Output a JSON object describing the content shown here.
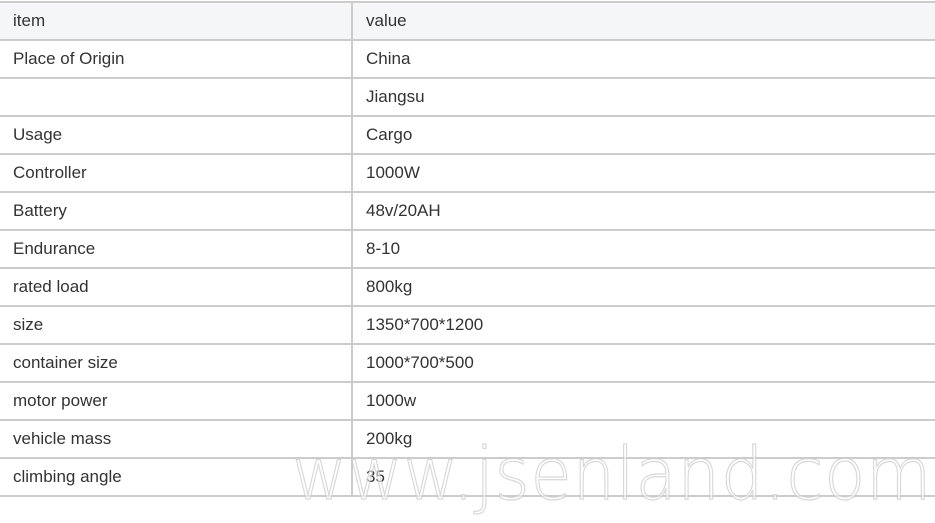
{
  "table": {
    "headers": {
      "item": "item",
      "value": "value"
    },
    "rows": [
      {
        "item": "Place of Origin",
        "value": "China"
      },
      {
        "item": "",
        "value": "Jiangsu"
      },
      {
        "item": "Usage",
        "value": "Cargo"
      },
      {
        "item": "Controller",
        "value": "1000W"
      },
      {
        "item": "Battery",
        "value": "48v/20AH"
      },
      {
        "item": "Endurance",
        "value": "8-10"
      },
      {
        "item": "rated load",
        "value": "800kg"
      },
      {
        "item": "size",
        "value": "1350*700*1200"
      },
      {
        "item": "container size",
        "value": "1000*700*500"
      },
      {
        "item": "motor power",
        "value": "1000w"
      },
      {
        "item": "vehicle mass",
        "value": "200kg"
      },
      {
        "item": "climbing angle",
        "value": "35"
      }
    ]
  },
  "watermark": "www.jsenland.com"
}
